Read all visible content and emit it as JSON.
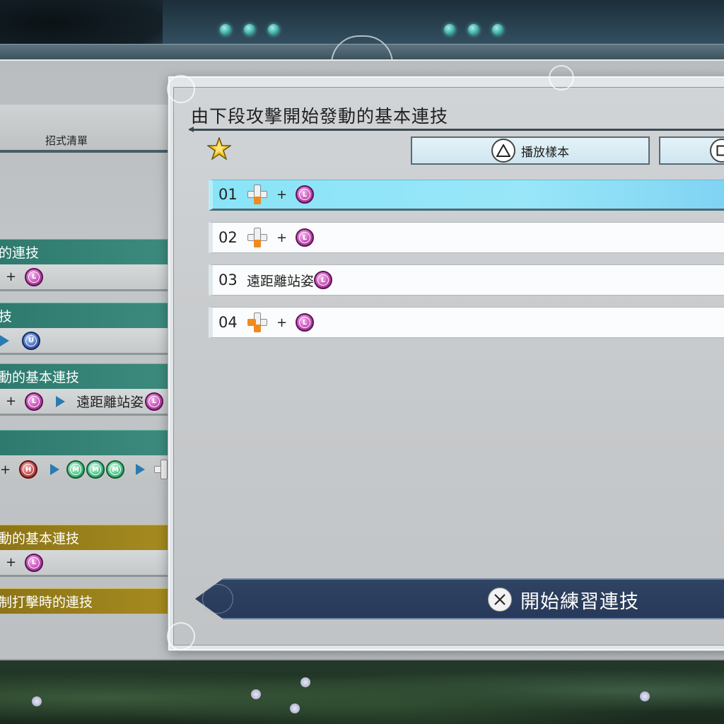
{
  "dialog": {
    "title": "由下段攻擊開始發動的基本連技",
    "play_sample_label": "播放樣本"
  },
  "combos": [
    {
      "num": "01",
      "plus": "+",
      "text": "",
      "selected": true
    },
    {
      "num": "02",
      "plus": "+",
      "text": "",
      "selected": false
    },
    {
      "num": "03",
      "plus": "",
      "text": "遠距離站姿",
      "selected": false
    },
    {
      "num": "04",
      "plus": "+",
      "text": "",
      "selected": false
    }
  ],
  "back_panel": {
    "header_label": "招式清單",
    "items": [
      {
        "title": "的連技",
        "plus": "+",
        "color": "teal"
      },
      {
        "title": "技",
        "color": "teal"
      },
      {
        "title": "動的基本連技",
        "plus": "+",
        "text": "遠距離站姿",
        "color": "teal"
      },
      {
        "title": "",
        "plus": "+",
        "color": "teal"
      },
      {
        "title": "動的基本連技",
        "plus": "+",
        "color": "gold"
      },
      {
        "title": "制打擊時的連技",
        "color": "gold"
      }
    ]
  },
  "buttons": {
    "L": "L",
    "U": "U",
    "H": "H",
    "M": "M"
  },
  "practice": {
    "label": "開始練習連技"
  },
  "colors": {
    "selected_row": "#8ae4f7",
    "teal_header": "#2e7a6e",
    "gold_header": "#8d7516",
    "practice_bar": "#2f4362"
  },
  "icons": [
    "star-icon",
    "triangle-icon",
    "square-icon",
    "cross-icon",
    "dpad-icon",
    "l-button-icon",
    "u-button-icon",
    "h-button-icon",
    "m-button-icon",
    "arrow-right-icon"
  ]
}
